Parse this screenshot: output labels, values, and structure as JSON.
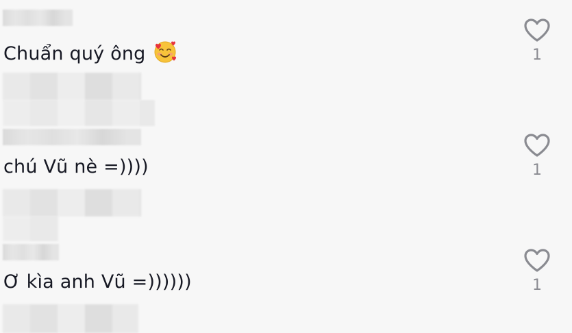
{
  "comments": [
    {
      "text": "Chuẩn quý ông",
      "has_emoji": true,
      "emoji_name": "smiling-face-with-hearts-icon",
      "like_count": "1"
    },
    {
      "text": "chú Vũ nè =))))",
      "has_emoji": false,
      "like_count": "1"
    },
    {
      "text": "Ơ kìa anh Vũ =))))))",
      "has_emoji": false,
      "like_count": "1"
    }
  ],
  "colors": {
    "background": "#f7f7f7",
    "text": "#161823",
    "muted": "#8a8b91",
    "heart_stroke": "#8a8b91"
  }
}
